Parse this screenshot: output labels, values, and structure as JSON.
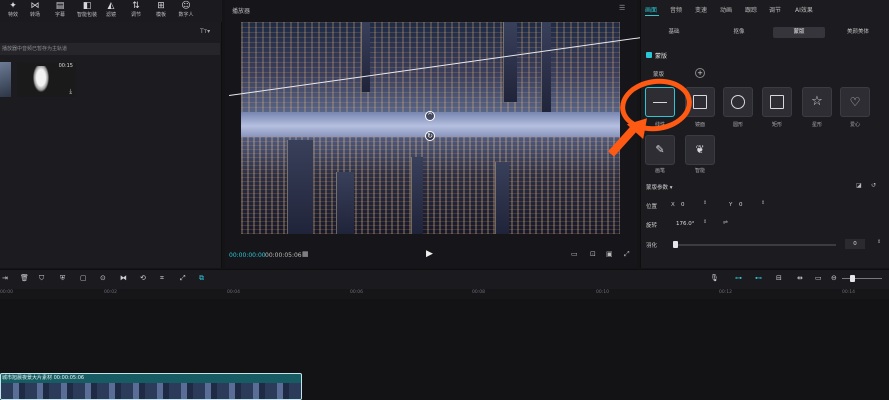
{
  "toolbar": {
    "items": [
      {
        "label": "特效",
        "icon": "magic-wand-icon",
        "glyph": "✦"
      },
      {
        "label": "转场",
        "icon": "transition-icon",
        "glyph": "⋈"
      },
      {
        "label": "字幕",
        "icon": "subtitle-icon",
        "glyph": "▤"
      },
      {
        "label": "智能包装",
        "icon": "smart-package-icon",
        "glyph": "◧"
      },
      {
        "label": "滤镜",
        "icon": "filter-icon",
        "glyph": "◭"
      },
      {
        "label": "调节",
        "icon": "adjust-icon",
        "glyph": "⇅"
      },
      {
        "label": "模板",
        "icon": "template-icon",
        "glyph": "⊞"
      },
      {
        "label": "数字人",
        "icon": "digital-human-icon",
        "glyph": "☺"
      }
    ]
  },
  "media": {
    "tt_label": "Tт▾",
    "hint": "播放器中音频已暂存为主轨道",
    "clip_duration": "00:15"
  },
  "player": {
    "title": "播放器",
    "timecode_current": "00:00:00:00",
    "timecode_total": "00:00:05:06"
  },
  "right_panel": {
    "tabs": [
      "画面",
      "音频",
      "变速",
      "动画",
      "跟踪",
      "调节",
      "AI效果"
    ],
    "subtabs": [
      "基础",
      "抠像",
      "蒙版",
      "美颜美体"
    ],
    "mask_label": "蒙版",
    "mask_chip": "蒙版",
    "shapes": [
      {
        "label": "线性",
        "icon": "linear-mask-icon"
      },
      {
        "label": "镜面",
        "icon": "mirror-mask-icon"
      },
      {
        "label": "圆形",
        "icon": "circle-mask-icon"
      },
      {
        "label": "矩形",
        "icon": "rectangle-mask-icon"
      },
      {
        "label": "星形",
        "icon": "star-mask-icon"
      },
      {
        "label": "爱心",
        "icon": "heart-mask-icon"
      },
      {
        "label": "画笔",
        "icon": "brush-mask-icon"
      },
      {
        "label": "智能",
        "icon": "smart-mask-icon"
      }
    ],
    "params_title": "蒙版参数 ▾",
    "position_label": "位置",
    "x_label": "X",
    "x_value": "0",
    "y_label": "Y",
    "y_value": "0",
    "rotation_label": "旋转",
    "rotation_value": "176.0°",
    "feather_label": "羽化",
    "feather_value": "0"
  },
  "timeline": {
    "ticks": [
      "00:00",
      "00:02",
      "00:04",
      "00:06",
      "00:08",
      "00:10",
      "00:12",
      "00:14"
    ],
    "clip_label": "城市旭晨夜景大片素材",
    "clip_time": "00:00:05:06"
  },
  "colors": {
    "accent": "#2bc7d6",
    "annotation": "#ff5a13"
  }
}
